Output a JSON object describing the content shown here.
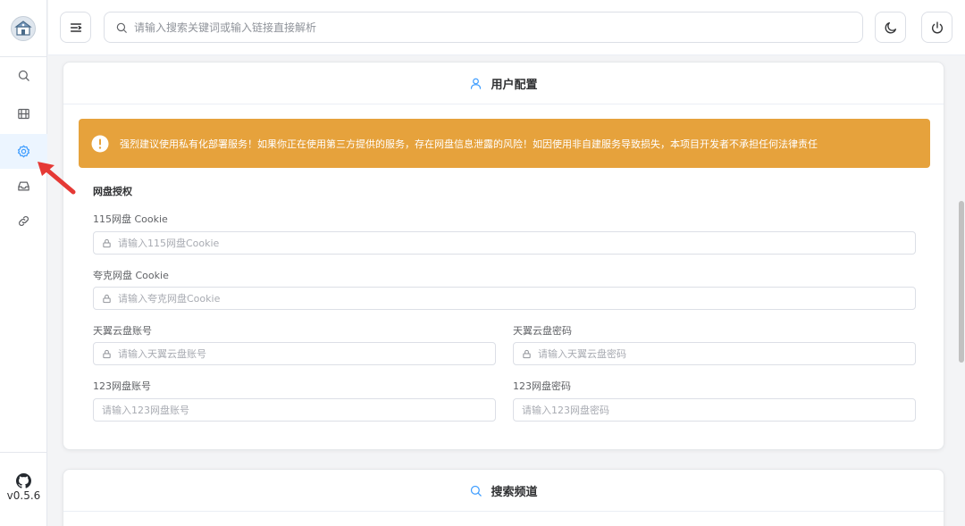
{
  "sidebar": {
    "logo_icon": "app-logo",
    "items": [
      {
        "name": "search",
        "icon": "search-icon",
        "active": false
      },
      {
        "name": "resources",
        "icon": "film-icon",
        "active": false
      },
      {
        "name": "settings",
        "icon": "gear-icon",
        "active": true
      },
      {
        "name": "cloud-drive",
        "icon": "inbox-icon",
        "active": false
      },
      {
        "name": "links",
        "icon": "link-icon",
        "active": false
      }
    ],
    "github_icon": "github-icon",
    "version": "v0.5.6"
  },
  "header": {
    "menu_icon": "menu-fold-icon",
    "search_placeholder": "请输入搜索关键词或输入链接直接解析",
    "theme_icon": "moon-icon",
    "logout_icon": "power-icon"
  },
  "user_config": {
    "title": "用户配置",
    "title_icon": "user-icon",
    "alert": {
      "icon": "warning-circle-icon",
      "text": "强烈建议使用私有化部署服务！如果你正在使用第三方提供的服务，存在网盘信息泄露的风险！如因使用非自建服务导致损失，本项目开发者不承担任何法律责任",
      "color": "#e6a23c"
    },
    "section_title": "网盘授权",
    "fields": {
      "cookie_115": {
        "label": "115网盘 Cookie",
        "placeholder": "请输入115网盘Cookie",
        "value": ""
      },
      "cookie_quark": {
        "label": "夸克网盘 Cookie",
        "placeholder": "请输入夸克网盘Cookie",
        "value": ""
      },
      "tianyi_account": {
        "label": "天翼云盘账号",
        "placeholder": "请输入天翼云盘账号",
        "value": ""
      },
      "tianyi_password": {
        "label": "天翼云盘密码",
        "placeholder": "请输入天翼云盘密码",
        "value": ""
      },
      "pan123_account": {
        "label": "123网盘账号",
        "placeholder": "请输入123网盘账号",
        "value": ""
      },
      "pan123_password": {
        "label": "123网盘密码",
        "placeholder": "请输入123网盘密码",
        "value": ""
      }
    }
  },
  "search_channels": {
    "title": "搜索频道",
    "title_icon": "search-icon"
  },
  "colors": {
    "accent": "#409eff",
    "warning": "#e6a23c",
    "annotation_arrow": "#e53935"
  }
}
